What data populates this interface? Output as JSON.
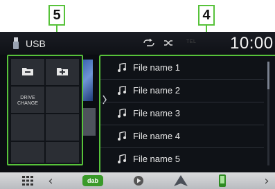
{
  "callouts": {
    "left": "5",
    "right": "4"
  },
  "topbar": {
    "source": "USB",
    "tel": "TEL",
    "clock": "10:00"
  },
  "left_panel": {
    "drive_change": "DRIVE\nCHANGE"
  },
  "file_list": [
    {
      "name": "File name 1"
    },
    {
      "name": "File name 2"
    },
    {
      "name": "File name 3"
    },
    {
      "name": "File name 4"
    },
    {
      "name": "File name 5"
    }
  ],
  "bottombar": {
    "left_chevron": "‹",
    "right_chevron": "›",
    "dab": "dab"
  },
  "colors": {
    "callout": "#57c23a",
    "screen_bg": "#0b0d12",
    "bottom_bar": "#c9cbce"
  }
}
